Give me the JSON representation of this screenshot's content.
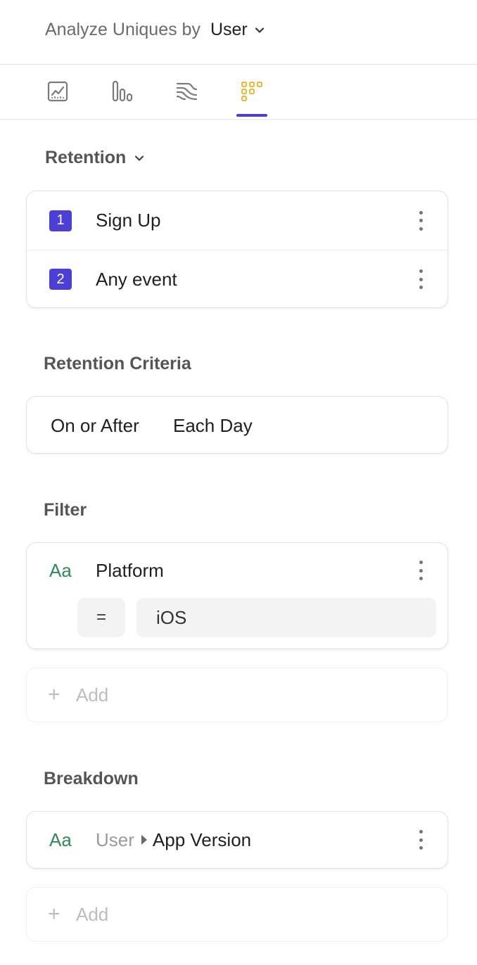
{
  "header": {
    "prefix": "Analyze Uniques by",
    "entity": "User"
  },
  "tabs": [
    {
      "name": "insights",
      "icon": "line-chart-icon",
      "color": "#7a7a7a"
    },
    {
      "name": "bar",
      "icon": "bar-chart-icon",
      "color": "#7a7a7a"
    },
    {
      "name": "flows",
      "icon": "flows-icon",
      "color": "#7a7a7a"
    },
    {
      "name": "retention",
      "icon": "retention-grid-icon",
      "color": "#f2b632",
      "active": true
    }
  ],
  "retention": {
    "title": "Retention",
    "events": [
      {
        "index": "1",
        "label": "Sign Up"
      },
      {
        "index": "2",
        "label": "Any event"
      }
    ]
  },
  "criteria": {
    "title": "Retention Criteria",
    "mode": "On or After",
    "period": "Each Day"
  },
  "filter": {
    "title": "Filter",
    "type_icon": "Aa",
    "property": "Platform",
    "operator": "=",
    "value": "iOS",
    "add_label": "Add",
    "add_icon": "+"
  },
  "breakdown": {
    "title": "Breakdown",
    "type_icon": "Aa",
    "entity": "User",
    "property": "App Version",
    "add_label": "Add",
    "add_icon": "+"
  },
  "colors": {
    "accent": "#4b3fd8",
    "active_tab": "#f2b632",
    "string_type": "#2e8b57"
  }
}
